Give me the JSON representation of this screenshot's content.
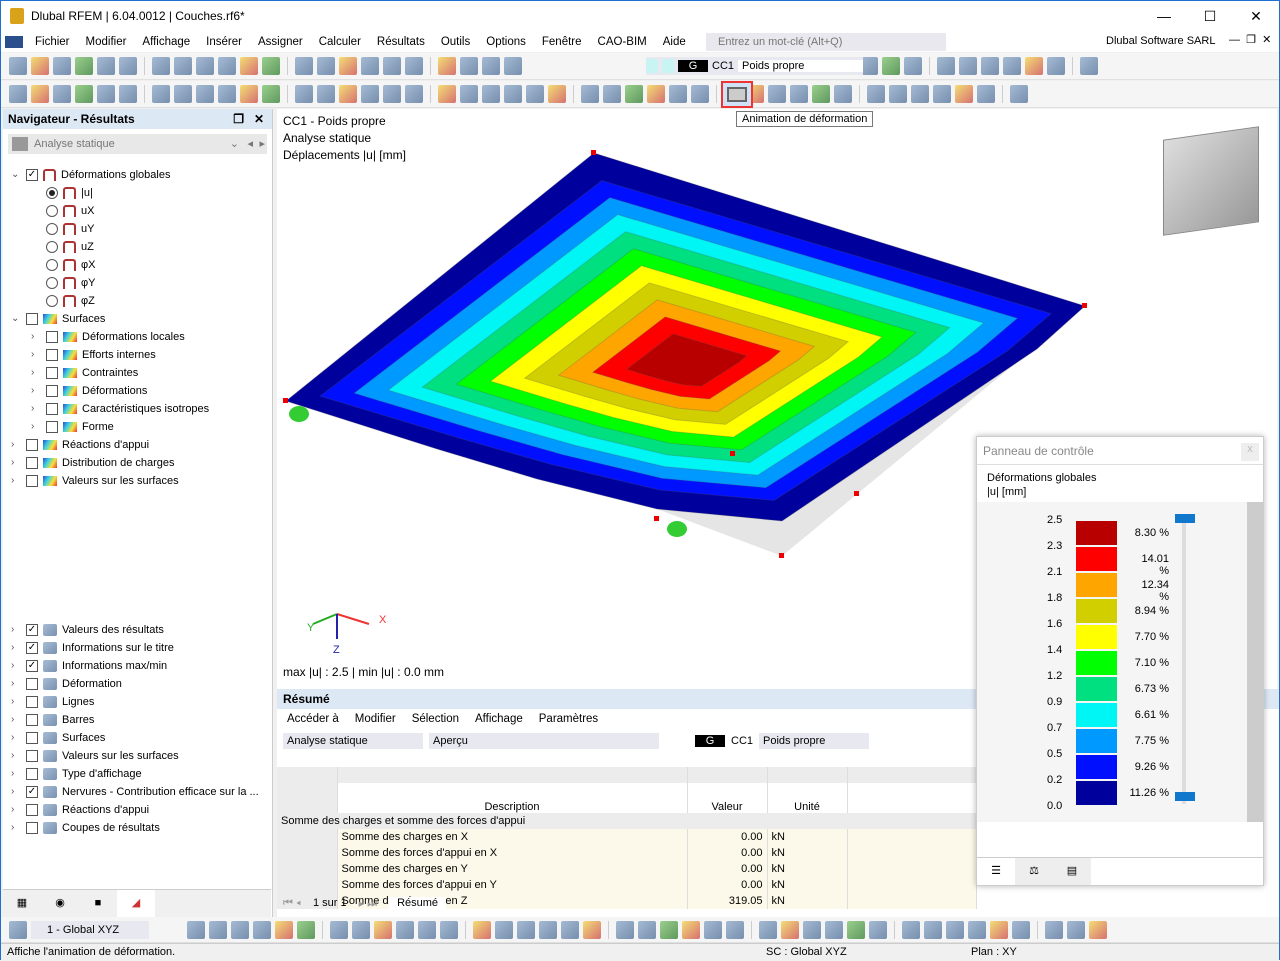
{
  "window": {
    "title": "Dlubal RFEM | 6.04.0012 | Couches.rf6*",
    "company": "Dlubal Software SARL"
  },
  "menu": [
    "Fichier",
    "Modifier",
    "Affichage",
    "Insérer",
    "Assigner",
    "Calculer",
    "Résultats",
    "Outils",
    "Options",
    "Fenêtre",
    "CAO-BIM",
    "Aide"
  ],
  "search": {
    "placeholder": "Entrez un mot-clé (Alt+Q)"
  },
  "toolbar": {
    "lc_type": "G",
    "lc": "CC1",
    "lc_name": "Poids propre",
    "tooltip": "Animation de déformation"
  },
  "navigator": {
    "title": "Navigateur - Résultats",
    "analysis": "Analyse statique",
    "top_items": [
      {
        "label": "Déformations globales",
        "kind": "check",
        "checked": true,
        "level": 0,
        "expand": "v"
      },
      {
        "label": "|u|",
        "kind": "radio",
        "checked": true,
        "level": 1
      },
      {
        "label": "uX",
        "kind": "radio",
        "level": 1
      },
      {
        "label": "uY",
        "kind": "radio",
        "level": 1
      },
      {
        "label": "uZ",
        "kind": "radio",
        "level": 1
      },
      {
        "label": "φX",
        "kind": "radio",
        "level": 1
      },
      {
        "label": "φY",
        "kind": "radio",
        "level": 1
      },
      {
        "label": "φZ",
        "kind": "radio",
        "level": 1
      },
      {
        "label": "Surfaces",
        "kind": "check",
        "level": 0,
        "expand": "v"
      },
      {
        "label": "Déformations locales",
        "kind": "check",
        "level": 1,
        "expand": ">"
      },
      {
        "label": "Efforts internes",
        "kind": "check",
        "level": 1,
        "expand": ">"
      },
      {
        "label": "Contraintes",
        "kind": "check",
        "level": 1,
        "expand": ">"
      },
      {
        "label": "Déformations",
        "kind": "check",
        "level": 1,
        "expand": ">"
      },
      {
        "label": "Caractéristiques isotropes",
        "kind": "check",
        "level": 1,
        "expand": ">"
      },
      {
        "label": "Forme",
        "kind": "check",
        "level": 1,
        "expand": ">"
      },
      {
        "label": "Réactions d'appui",
        "kind": "check",
        "level": 0,
        "expand": ">"
      },
      {
        "label": "Distribution de charges",
        "kind": "check",
        "level": 0,
        "expand": ">"
      },
      {
        "label": "Valeurs sur les surfaces",
        "kind": "check",
        "level": 0,
        "expand": ">"
      }
    ],
    "bottom_items": [
      {
        "label": "Valeurs des résultats",
        "checked": true
      },
      {
        "label": "Informations sur le titre",
        "checked": true
      },
      {
        "label": "Informations max/min",
        "checked": true
      },
      {
        "label": "Déformation"
      },
      {
        "label": "Lignes"
      },
      {
        "label": "Barres"
      },
      {
        "label": "Surfaces"
      },
      {
        "label": "Valeurs sur les surfaces"
      },
      {
        "label": "Type d'affichage"
      },
      {
        "label": "Nervures - Contribution efficace sur la ...",
        "checked": true
      },
      {
        "label": "Réactions d'appui"
      },
      {
        "label": "Coupes de résultats"
      }
    ]
  },
  "viewport": {
    "line1": "CC1 - Poids propre",
    "line2": "Analyse statique",
    "line3": "Déplacements |u| [mm]",
    "maxmin": "max |u| : 2.5 | min |u| : 0.0 mm",
    "axis_x": "X",
    "axis_y": "Y",
    "axis_z": "Z"
  },
  "control_panel": {
    "title": "Panneau de contrôle",
    "close": "x",
    "heading": "Déformations globales",
    "unit": "|u| [mm]",
    "values": [
      "2.5",
      "2.3",
      "2.1",
      "1.8",
      "1.6",
      "1.4",
      "1.2",
      "0.9",
      "0.7",
      "0.5",
      "0.2",
      "0.0"
    ],
    "bands": [
      {
        "color": "#b80000",
        "pct": "8.30 %"
      },
      {
        "color": "#ff0000",
        "pct": "14.01 %"
      },
      {
        "color": "#ffa500",
        "pct": "12.34 %"
      },
      {
        "color": "#d2cf00",
        "pct": "8.94 %"
      },
      {
        "color": "#ffff00",
        "pct": "7.70 %"
      },
      {
        "color": "#00ff00",
        "pct": "7.10 %"
      },
      {
        "color": "#00e080",
        "pct": "6.73 %"
      },
      {
        "color": "#00f5f5",
        "pct": "6.61 %"
      },
      {
        "color": "#0099ff",
        "pct": "7.75 %"
      },
      {
        "color": "#0010ff",
        "pct": "9.26 %"
      },
      {
        "color": "#00009c",
        "pct": "11.26 %"
      }
    ]
  },
  "resume": {
    "title": "Résumé",
    "menu": [
      "Accéder à",
      "Modifier",
      "Sélection",
      "Affichage",
      "Paramètres"
    ],
    "analysis": "Analyse statique",
    "view": "Aperçu",
    "lc_type": "G",
    "lc": "CC1",
    "lc_name": "Poids propre",
    "columns": [
      "Description",
      "Valeur",
      "Unité"
    ],
    "group": "Somme des charges et somme des forces d'appui",
    "rows": [
      {
        "desc": "Somme des charges en X",
        "value": "0.00",
        "unit": "kN"
      },
      {
        "desc": "Somme des forces d'appui en X",
        "value": "0.00",
        "unit": "kN"
      },
      {
        "desc": "Somme des charges en Y",
        "value": "0.00",
        "unit": "kN"
      },
      {
        "desc": "Somme des forces d'appui en Y",
        "value": "0.00",
        "unit": "kN"
      },
      {
        "desc": "Somme des charges en Z",
        "value": "319.05",
        "unit": "kN"
      }
    ],
    "pager": "1 sur 1",
    "tab": "Résumé"
  },
  "bottom_toolbar": {
    "cs": "1 - Global XYZ"
  },
  "status": {
    "message": "Affiche l'animation de déformation.",
    "cs": "SC : Global XYZ",
    "plane": "Plan : XY"
  }
}
